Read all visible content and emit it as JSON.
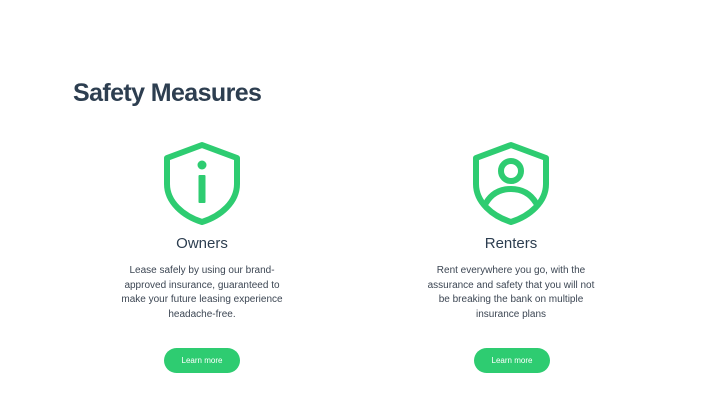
{
  "section": {
    "title": "Safety Measures"
  },
  "colors": {
    "accent": "#2ecc71",
    "heading": "#2d3e50",
    "body_text": "#3c4653"
  },
  "cards": [
    {
      "icon": "shield-info-icon",
      "heading": "Owners",
      "description": "Lease safely by using our brand-approved insurance, guaranteed to make your future leasing experience headache-free.",
      "button_label": "Learn more"
    },
    {
      "icon": "shield-user-icon",
      "heading": "Renters",
      "description": "Rent everywhere you go, with the assurance and safety that you will not be breaking the bank on multiple insurance plans",
      "button_label": "Learn more"
    }
  ]
}
